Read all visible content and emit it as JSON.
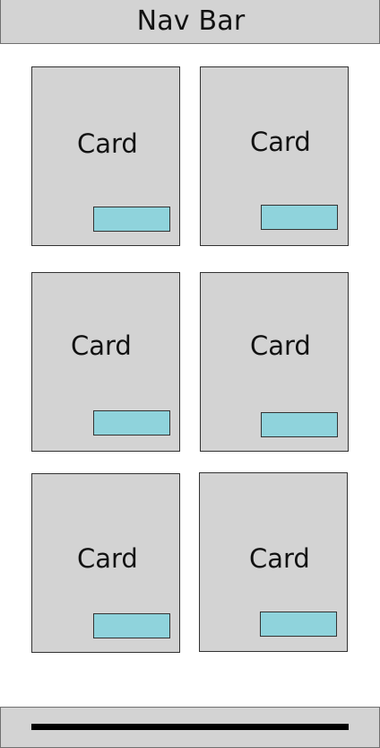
{
  "nav": {
    "title": "Nav Bar"
  },
  "cards": [
    {
      "label": "Card"
    },
    {
      "label": "Card"
    },
    {
      "label": "Card"
    },
    {
      "label": "Card"
    },
    {
      "label": "Card"
    },
    {
      "label": "Card"
    }
  ],
  "colors": {
    "background": "#ffffff",
    "panel": "#d3d3d3",
    "button": "#8fd3dc",
    "border": "#333333",
    "indicator": "#000000"
  }
}
